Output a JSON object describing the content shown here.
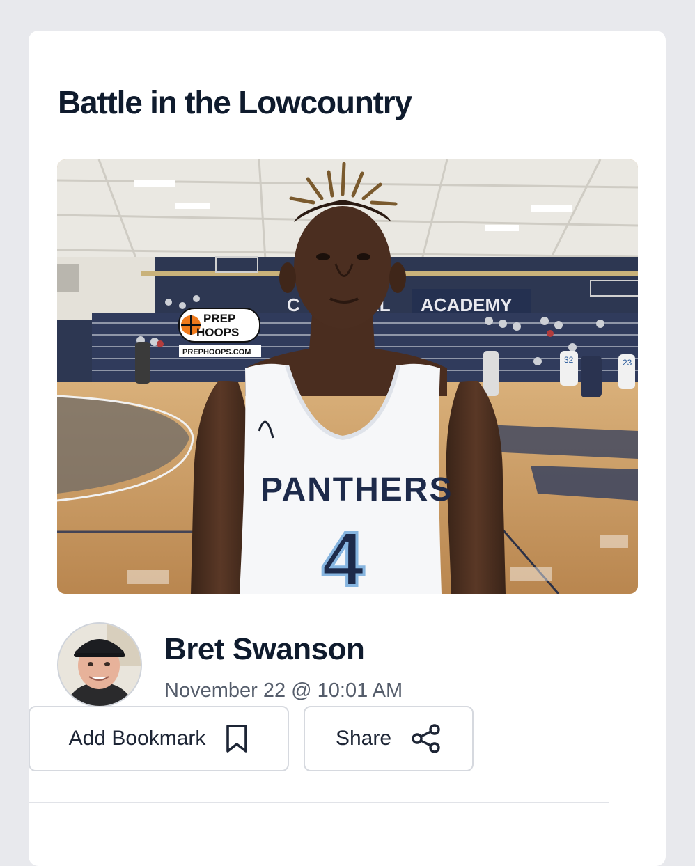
{
  "article": {
    "title": "Battle in the Lowcountry"
  },
  "photo": {
    "watermark_line1": "PREP",
    "watermark_line2": "HOOPS",
    "watermark_url": "PREPHOOPS.COM",
    "banner_text": "ACADEMY",
    "banner_text_left": "C",
    "banner_text_mid": "AL",
    "jersey_team": "PANTHERS",
    "jersey_number": "4",
    "ref_number_a": "32",
    "ref_number_b": "23"
  },
  "author": {
    "name": "Bret Swanson",
    "date": "November 22 @ 10:01 AM"
  },
  "actions": {
    "bookmark_label": "Add Bookmark",
    "bookmark_icon": "bookmark-icon",
    "share_label": "Share",
    "share_icon": "share-icon"
  },
  "colors": {
    "title": "#0f1b2d",
    "card_bg": "#ffffff",
    "page_bg": "#e8e9ed",
    "button_border": "#d6d9df"
  }
}
